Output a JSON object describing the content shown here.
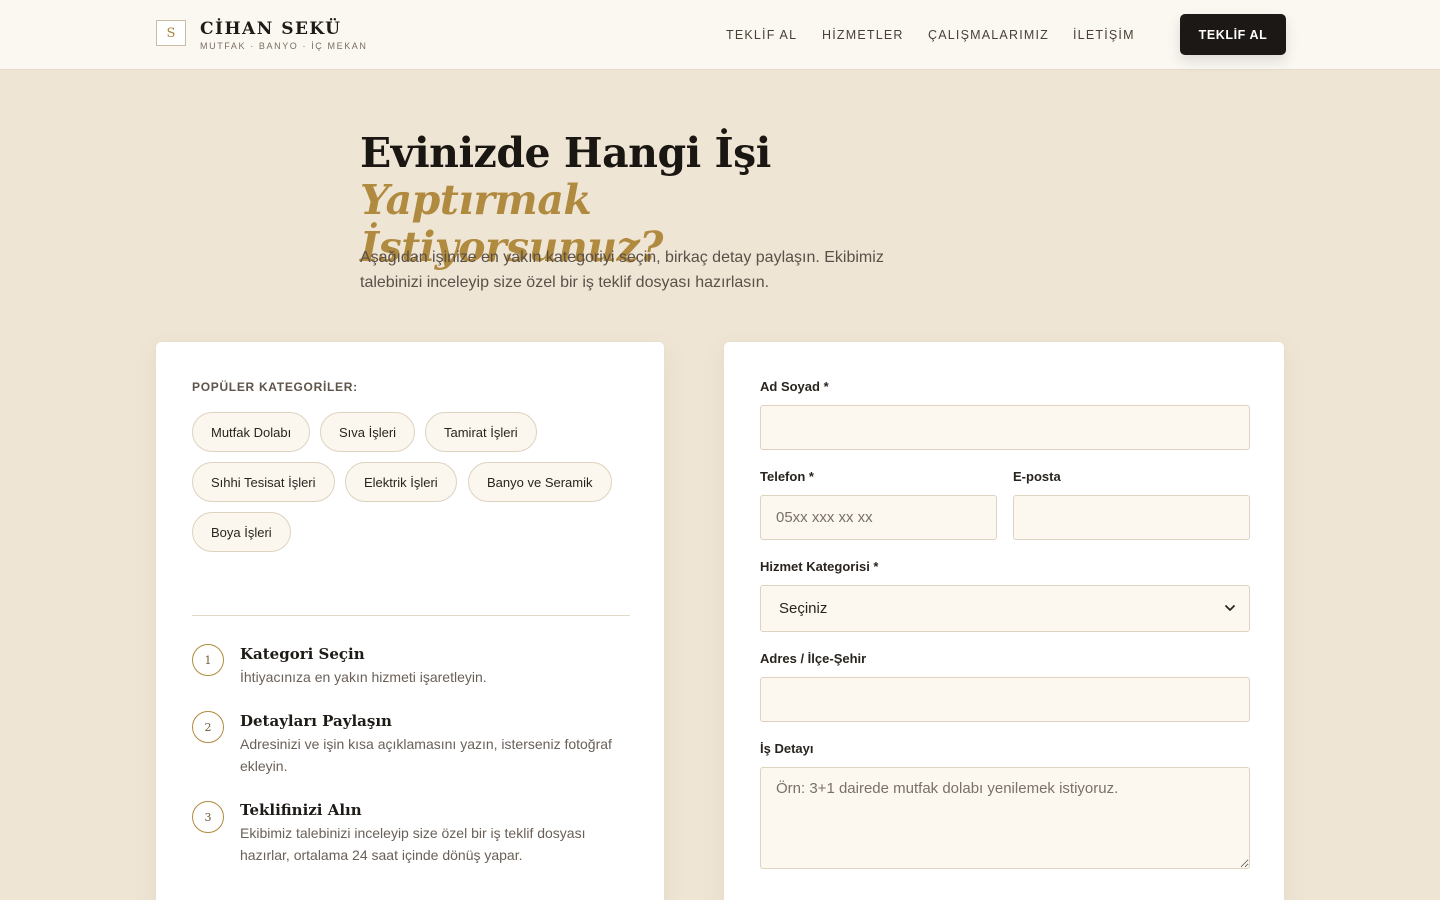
{
  "brand": {
    "logo_letter": "S",
    "name": "CİHAN SEKÜ",
    "tagline": "MUTFAK · BANYO · İÇ MEKAN"
  },
  "nav": {
    "links": [
      "TEKLİF AL",
      "HİZMETLER",
      "ÇALIŞMALARIMIZ",
      "İLETİŞİM"
    ],
    "cta": "TEKLİF AL"
  },
  "hero": {
    "title_main": "Evinizde Hangi İşi ",
    "title_accent_1": "Yaptırmak",
    "title_accent_2": "İstiyorsunuz?",
    "description": "Aşağıdan işinize en yakın kategoriyi seçin, birkaç detay paylaşın. Ekibimiz talebinizi inceleyip size özel bir iş teklif dosyası hazırlasın."
  },
  "categories": {
    "label": "POPÜLER KATEGORİLER:",
    "items": [
      "Mutfak Dolabı",
      "Sıva İşleri",
      "Tamirat İşleri",
      "Sıhhi Tesisat İşleri",
      "Elektrik İşleri",
      "Banyo ve Seramik",
      "Boya İşleri"
    ]
  },
  "steps": [
    {
      "num": "1",
      "title": "Kategori Seçin",
      "desc": "İhtiyacınıza en yakın hizmeti işaretleyin."
    },
    {
      "num": "2",
      "title": "Detayları Paylaşın",
      "desc": "Adresinizi ve işin kısa açıklamasını yazın, isterseniz fotoğraf ekleyin."
    },
    {
      "num": "3",
      "title": "Teklifinizi Alın",
      "desc": "Ekibimiz talebinizi inceleyip size özel bir iş teklif dosyası hazırlar, ortalama 24 saat içinde dönüş yapar."
    }
  ],
  "form": {
    "name_label": "Ad Soyad *",
    "phone_label": "Telefon *",
    "phone_placeholder": "05xx xxx xx xx",
    "email_label": "E-posta",
    "category_label": "Hizmet Kategorisi *",
    "category_value": "Seçiniz",
    "address_label": "Adres / İlçe-Şehir",
    "detail_label": "İş Detayı",
    "detail_placeholder": "Örn: 3+1 dairede mutfak dolabı yenilemek istiyoruz."
  },
  "icons": {
    "select_arrow": "chevron-down-icon"
  },
  "colors": {
    "background": "#efe5d5",
    "header": "#fbf8f2",
    "accent": "#b08a3e",
    "dark": "#1c1815"
  }
}
